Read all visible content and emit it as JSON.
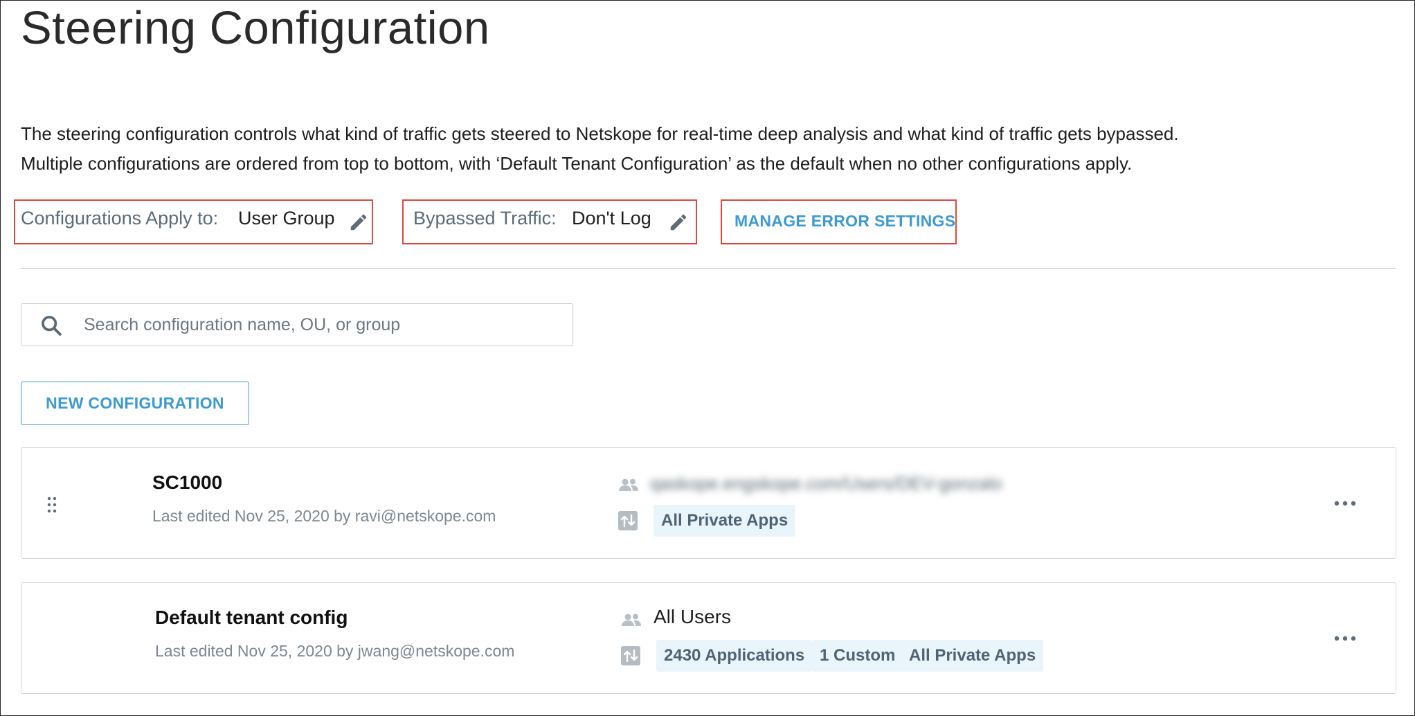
{
  "page": {
    "title": "Steering Configuration",
    "description_line1": "The steering configuration controls what kind of traffic gets steered to Netskope for real-time deep analysis and what kind of traffic gets bypassed.",
    "description_line2": "Multiple configurations are ordered from top to bottom, with ‘Default Tenant Configuration’ as the default when no other configurations apply."
  },
  "settings": {
    "apply_label": "Configurations Apply to:",
    "apply_value": "User Group",
    "bypass_label": "Bypassed Traffic:",
    "bypass_value": "Don't Log",
    "manage_errors_label": "MANAGE ERROR SETTINGS"
  },
  "search": {
    "placeholder": "Search configuration name, OU, or group"
  },
  "new_button_label": "NEW CONFIGURATION",
  "configs": [
    {
      "name": "SC1000",
      "meta": "Last edited Nov 25, 2020 by ravi@netskope.com",
      "users": "qaskope.engskope.com/Users/DEV-gonzalo",
      "tags": [
        "All Private Apps"
      ]
    },
    {
      "name": "Default tenant config",
      "meta": "Last edited Nov 25, 2020 by jwang@netskope.com",
      "users": "All Users",
      "tags": [
        "2430 Applications",
        "1 Custom",
        "All Private Apps"
      ]
    }
  ],
  "colors": {
    "accent": "#3b9ad2",
    "highlight_box": "#e0483b",
    "tag_bg": "#eaf4fb"
  }
}
